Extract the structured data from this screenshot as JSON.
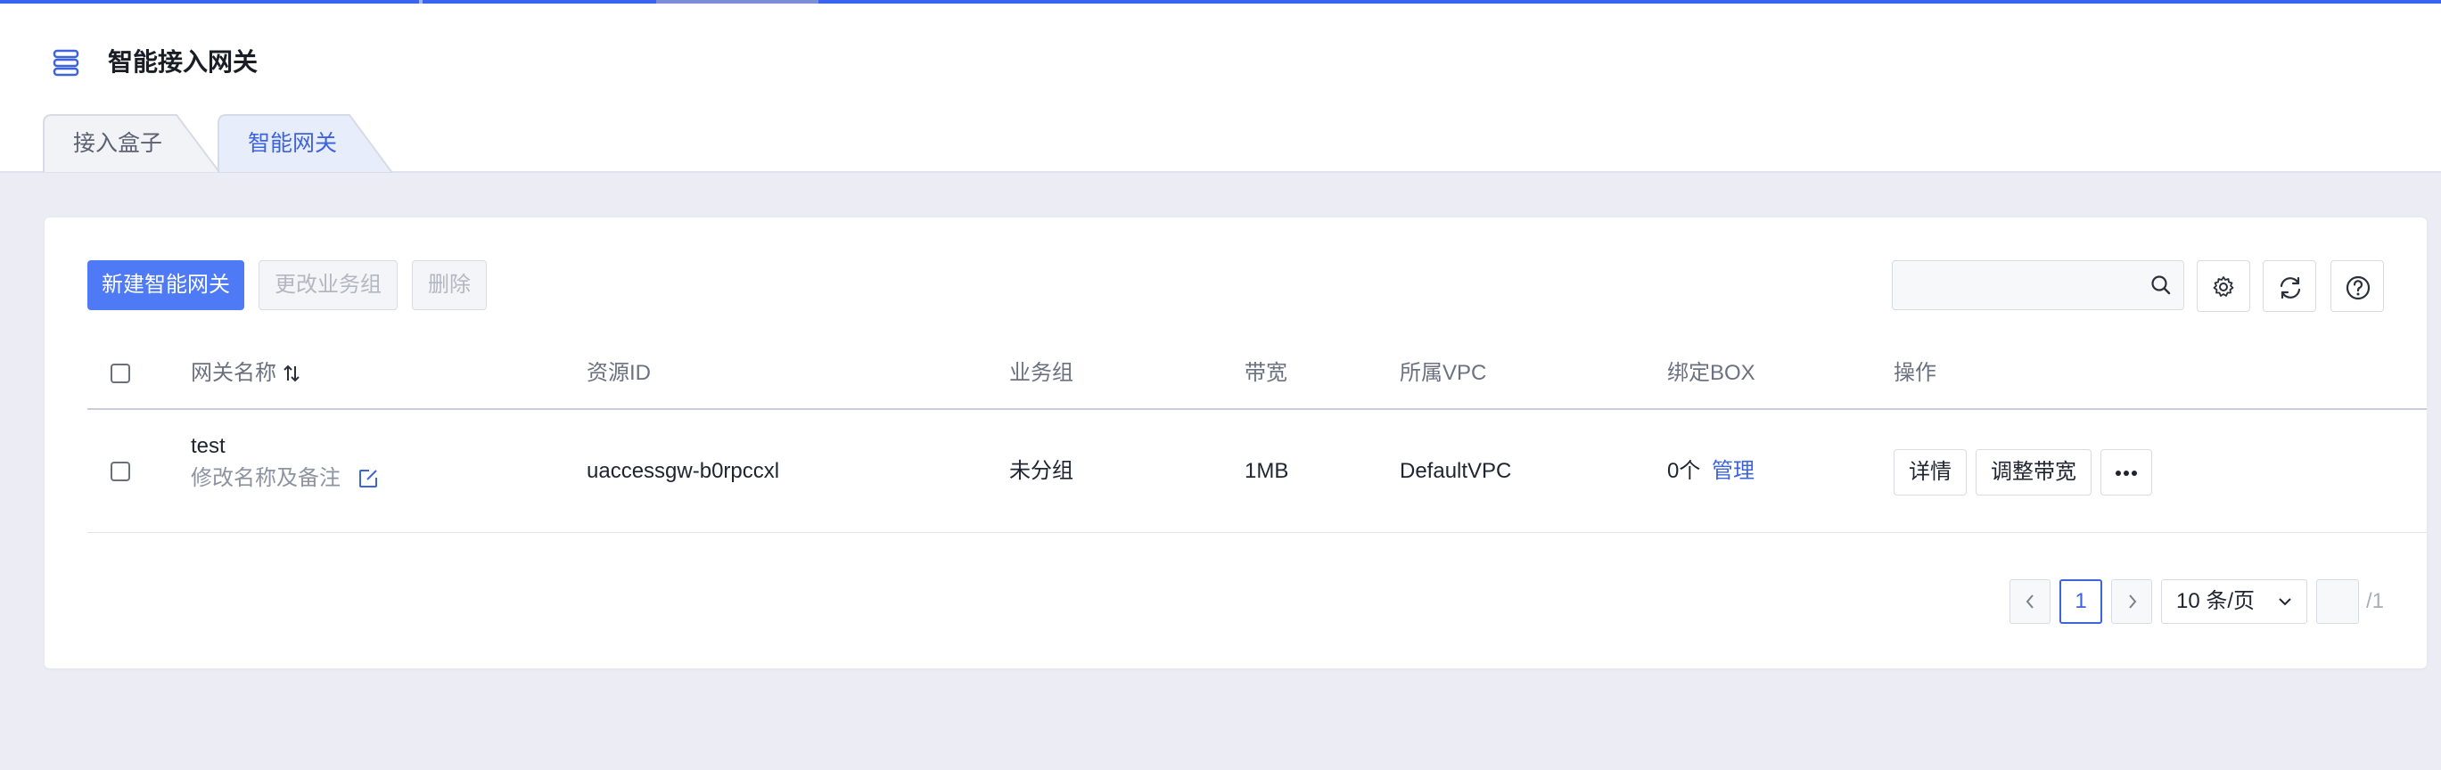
{
  "header": {
    "title": "智能接入网关"
  },
  "tabs": [
    {
      "label": "接入盒子",
      "active": false
    },
    {
      "label": "智能网关",
      "active": true
    }
  ],
  "toolbar": {
    "create_label": "新建智能网关",
    "change_group_label": "更改业务组",
    "delete_label": "删除",
    "search_placeholder": ""
  },
  "table": {
    "columns": [
      "网关名称",
      "资源ID",
      "业务组",
      "带宽",
      "所属VPC",
      "绑定BOX",
      "操作"
    ],
    "rows": [
      {
        "name": "test",
        "name_edit_label": "修改名称及备注",
        "resource_id": "uaccessgw-b0rpccxl",
        "group": "未分组",
        "bandwidth": "1MB",
        "vpc": "DefaultVPC",
        "box_count": "0个",
        "box_manage_label": "管理",
        "actions": [
          "详情",
          "调整带宽",
          "···"
        ]
      }
    ]
  },
  "pagination": {
    "current_page": "1",
    "page_size_label": "10 条/页",
    "jump_value": "",
    "total_label": "/1"
  },
  "colors": {
    "accent": "#3d63dd",
    "primary_button": "#4e7bf5",
    "page_background": "#ecedf4"
  }
}
